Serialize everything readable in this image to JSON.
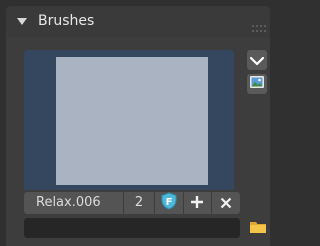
{
  "panel": {
    "title": "Brushes"
  },
  "brush": {
    "name": "Relax.006",
    "users": "2"
  },
  "icons": {
    "collapse": "triangle-down-icon",
    "grip": "drag-grip-icon",
    "dropdown": "chevron-down-icon",
    "image": "image-icon",
    "fake_user": "shield-f-icon",
    "add": "plus-icon",
    "remove": "close-icon",
    "folder": "folder-icon"
  },
  "colors": {
    "accent": "#5680c2",
    "fake_user": "#4fb8d8",
    "folder": "#f0c040"
  }
}
